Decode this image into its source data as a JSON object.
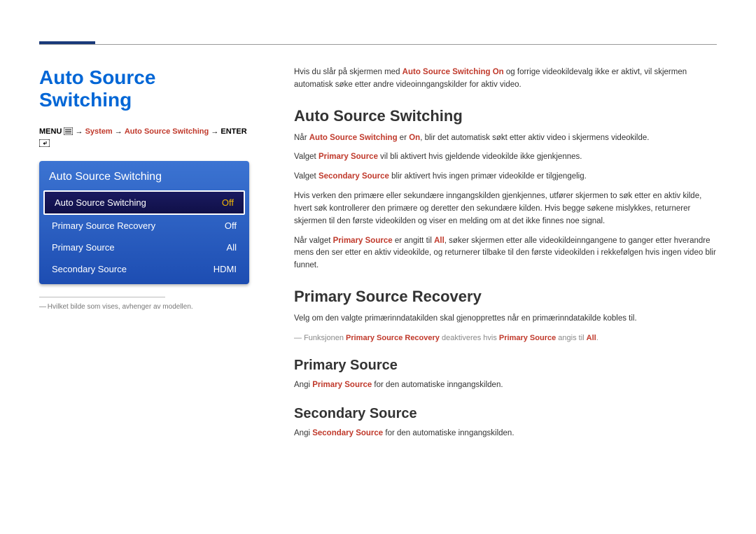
{
  "page_title": "Auto Source Switching",
  "breadcrumb": {
    "menu_label": "MENU",
    "arrow": "→",
    "system": "System",
    "feature": "Auto Source Switching",
    "enter_label": "ENTER"
  },
  "osd": {
    "title": "Auto Source Switching",
    "items": [
      {
        "label": "Auto Source Switching",
        "value": "Off",
        "selected": true
      },
      {
        "label": "Primary Source Recovery",
        "value": "Off",
        "selected": false
      },
      {
        "label": "Primary Source",
        "value": "All",
        "selected": false
      },
      {
        "label": "Secondary Source",
        "value": "HDMI",
        "selected": false
      }
    ]
  },
  "footnote": "Hvilket bilde som vises, avhenger av modellen.",
  "intro": {
    "p1_a": "Hvis du slår på skjermen med ",
    "p1_hl": "Auto Source Switching On",
    "p1_b": " og forrige videokildevalg ikke er aktivt, vil skjermen automatisk søke etter andre videoinngangskilder for aktiv video."
  },
  "section1": {
    "heading": "Auto Source Switching",
    "p1_a": "Når ",
    "p1_hl1": "Auto Source Switching",
    "p1_b": " er ",
    "p1_hl2": "On",
    "p1_c": ", blir det automatisk søkt etter aktiv video i skjermens videokilde.",
    "p2_a": "Valget ",
    "p2_hl": "Primary Source",
    "p2_b": " vil bli aktivert hvis gjeldende videokilde ikke gjenkjennes.",
    "p3_a": "Valget ",
    "p3_hl": "Secondary Source",
    "p3_b": " blir aktivert hvis ingen primær videokilde er tilgjengelig.",
    "p4": "Hvis verken den primære eller sekundære inngangskilden gjenkjennes, utfører skjermen to søk etter en aktiv kilde, hvert søk kontrollerer den primære og deretter den sekundære kilden. Hvis begge søkene mislykkes, returnerer skjermen til den første videokilden og viser en melding om at det ikke finnes noe signal.",
    "p5_a": "Når valget ",
    "p5_hl1": "Primary Source",
    "p5_b": " er angitt til ",
    "p5_hl2": "All",
    "p5_c": ", søker skjermen etter alle videokildeinngangene to ganger etter hverandre mens den ser etter en aktiv videokilde, og returnerer tilbake til den første videokilden i rekkefølgen hvis ingen video blir funnet."
  },
  "section2": {
    "heading": "Primary Source Recovery",
    "p1": "Velg om den valgte primærinndatakilden skal gjenopprettes når en primærinndatakilde kobles til.",
    "note_a": "Funksjonen ",
    "note_hl1": "Primary Source Recovery",
    "note_b": " deaktiveres hvis ",
    "note_hl2": "Primary Source",
    "note_c": " angis til ",
    "note_hl3": "All",
    "note_d": "."
  },
  "section3": {
    "heading": "Primary Source",
    "p1_a": "Angi ",
    "p1_hl": "Primary Source",
    "p1_b": " for den automatiske inngangskilden."
  },
  "section4": {
    "heading": "Secondary Source",
    "p1_a": "Angi ",
    "p1_hl": "Secondary Source",
    "p1_b": " for den automatiske inngangskilden."
  }
}
